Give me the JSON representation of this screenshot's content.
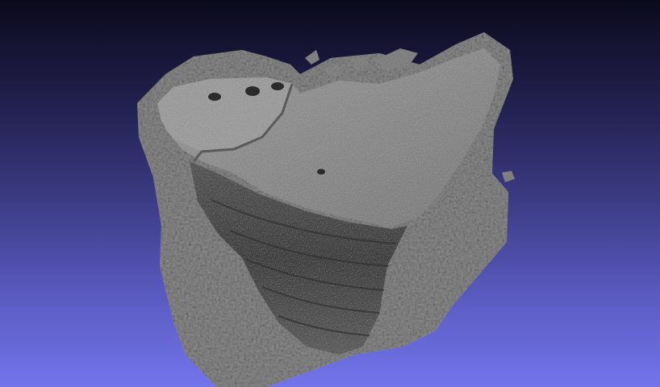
{
  "viewer": {
    "background_top": "#0a0a1c",
    "background_bottom": "#7374ea",
    "mesh_color": "#8a8a8a"
  },
  "model": {
    "icon": "rock-mesh-icon",
    "cup_marks": 4
  }
}
